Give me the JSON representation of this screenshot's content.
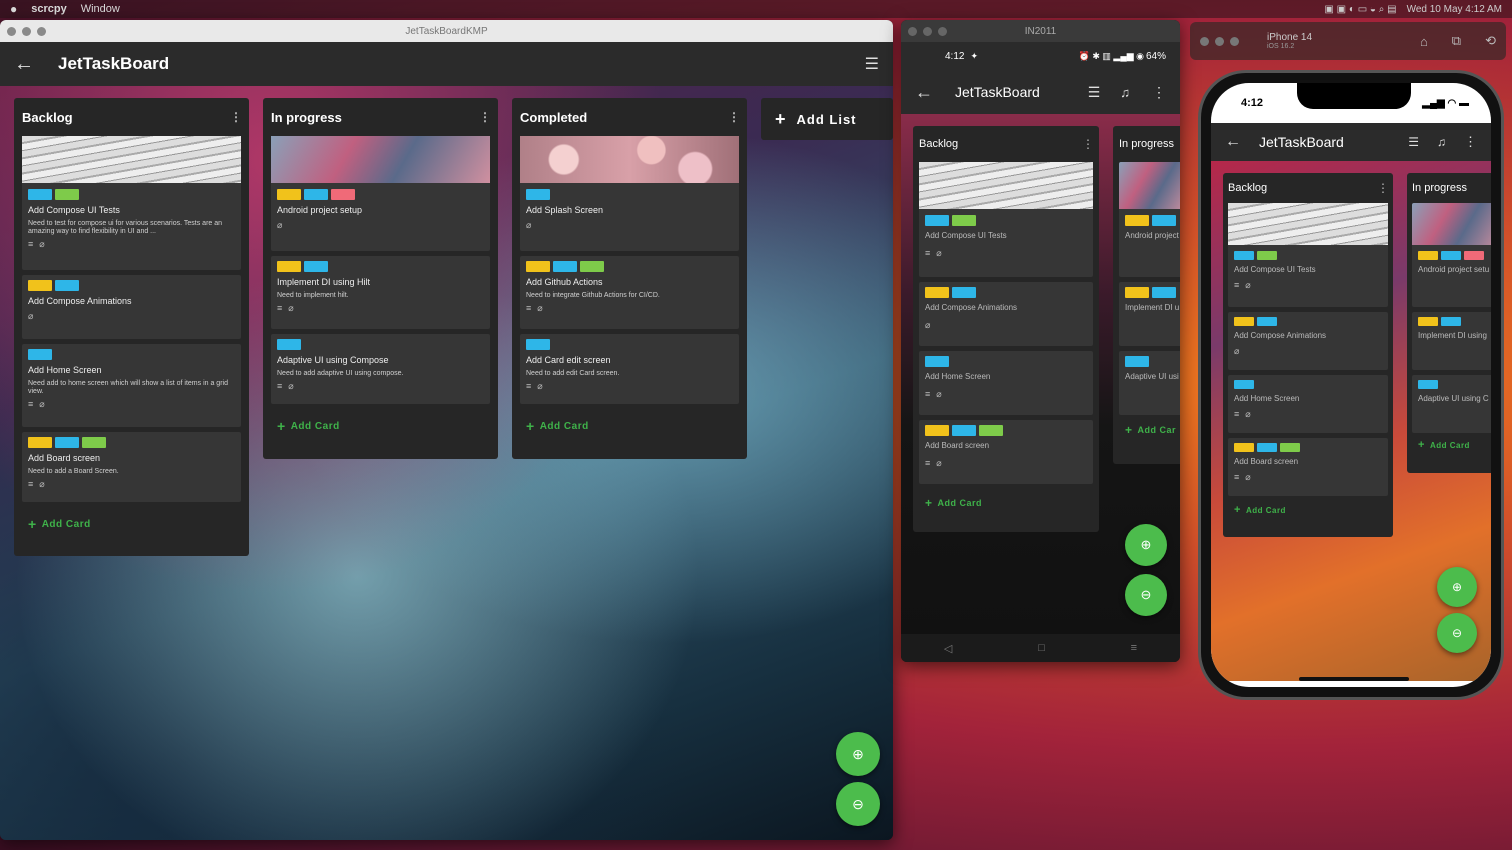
{
  "menubar": {
    "apple": "",
    "app": "scrcpy",
    "menu": "Window",
    "clock": "Wed 10 May 4:12 AM"
  },
  "desktop": {
    "window_title": "JetTaskBoardKMP",
    "app_title": "JetTaskBoard",
    "add_list": "Add List",
    "add_card": "Add Card",
    "lists": [
      {
        "title": "Backlog",
        "cards": [
          {
            "labels": [
              "#2eb6e8",
              "#7ecb4a"
            ],
            "title": "Add Compose UI Tests",
            "desc": "Need to test for compose ui for various scenarios. Tests are an amazing way to find flexibility in UI and ..."
          },
          {
            "labels": [
              "#f1c21b",
              "#2eb6e8"
            ],
            "title": "Add Compose Animations",
            "desc": ""
          },
          {
            "labels": [
              "#2eb6e8"
            ],
            "title": "Add Home Screen",
            "desc": "Need add to home screen which will show a list of items in a grid view."
          },
          {
            "labels": [
              "#f1c21b",
              "#2eb6e8",
              "#7ecb4a"
            ],
            "title": "Add Board screen",
            "desc": "Need to add a Board Screen."
          }
        ]
      },
      {
        "title": "In progress",
        "cards": [
          {
            "labels": [
              "#f1c21b",
              "#2eb6e8",
              "#f06a78"
            ],
            "title": "Android project setup",
            "desc": ""
          },
          {
            "labels": [
              "#f1c21b",
              "#2eb6e8"
            ],
            "title": "Implement DI using Hilt",
            "desc": "Need to implement hilt."
          },
          {
            "labels": [
              "#2eb6e8"
            ],
            "title": "Adaptive UI using Compose",
            "desc": "Need to add adaptive UI using compose."
          }
        ]
      },
      {
        "title": "Completed",
        "cards": [
          {
            "labels": [
              "#2eb6e8"
            ],
            "title": "Add Splash Screen",
            "desc": ""
          },
          {
            "labels": [
              "#f1c21b",
              "#2eb6e8",
              "#7ecb4a"
            ],
            "title": "Add Github Actions",
            "desc": "Need to integrate Github Actions for CI/CD."
          },
          {
            "labels": [
              "#2eb6e8"
            ],
            "title": "Add Card edit screen",
            "desc": "Need to add edit Card screen."
          }
        ]
      }
    ]
  },
  "android": {
    "window_title": "IN2011",
    "time": "4:12",
    "battery": "64%",
    "app_title": "JetTaskBoard",
    "col1": "Backlog",
    "col2": "In progress",
    "add_card": "Add Card",
    "add_card_short": "Add Car",
    "cards": [
      "Add Compose UI Tests",
      "Add Compose Animations",
      "Add Home Screen",
      "Add Board screen"
    ],
    "cards2": [
      "Android project",
      "Implement DI u",
      "Adaptive UI usi"
    ]
  },
  "ios": {
    "window_title": "iPhone 14",
    "window_sub": "iOS 16.2",
    "time": "4:12",
    "app_title": "JetTaskBoard",
    "col1": "Backlog",
    "col2": "In progress",
    "add_card": "Add Card",
    "cards": [
      "Add Compose UI Tests",
      "Add Compose Animations",
      "Add Home Screen",
      "Add Board screen"
    ],
    "cards2": [
      "Android project setu",
      "Implement DI using",
      "Adaptive UI using C"
    ]
  }
}
